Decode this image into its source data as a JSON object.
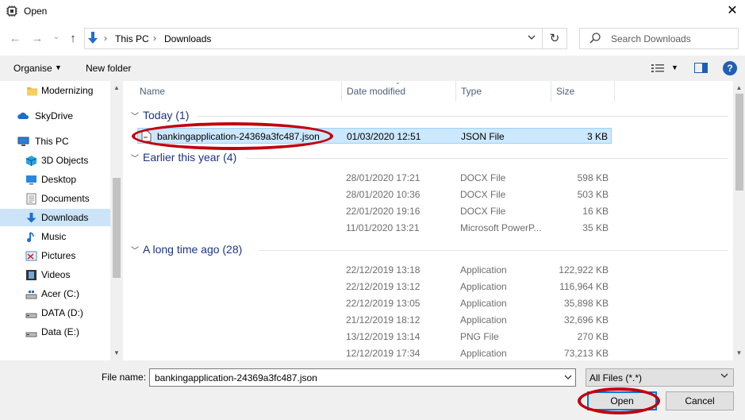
{
  "window": {
    "title": "Open",
    "close_glyph": "✕"
  },
  "navigation": {
    "back_glyph": "←",
    "forward_glyph": "→",
    "recent_glyph": "⌄",
    "up_glyph": "↑",
    "breadcrumb": [
      "This PC",
      "Downloads"
    ],
    "separator": "›",
    "refresh_glyph": "↻",
    "search_placeholder": "Search Downloads"
  },
  "toolbar": {
    "organise_label": "Organise",
    "new_folder_label": "New folder",
    "help_glyph": "?"
  },
  "sidebar": {
    "items": [
      {
        "label": "Modernizing",
        "icon": "folder-icon",
        "selected": false
      },
      {
        "label": "SkyDrive",
        "icon": "cloud-icon",
        "selected": false
      },
      {
        "label": "This PC",
        "icon": "computer-icon",
        "selected": false
      },
      {
        "label": "3D Objects",
        "icon": "3d-objects-icon",
        "selected": false
      },
      {
        "label": "Desktop",
        "icon": "desktop-icon",
        "selected": false
      },
      {
        "label": "Documents",
        "icon": "documents-icon",
        "selected": false
      },
      {
        "label": "Downloads",
        "icon": "downloads-icon",
        "selected": true
      },
      {
        "label": "Music",
        "icon": "music-icon",
        "selected": false
      },
      {
        "label": "Pictures",
        "icon": "pictures-icon",
        "selected": false
      },
      {
        "label": "Videos",
        "icon": "videos-icon",
        "selected": false
      },
      {
        "label": "Acer (C:)",
        "icon": "drive-c-icon",
        "selected": false
      },
      {
        "label": "DATA (D:)",
        "icon": "drive-icon",
        "selected": false
      },
      {
        "label": "Data (E:)",
        "icon": "drive-icon",
        "selected": false
      }
    ]
  },
  "columns": {
    "name": "Name",
    "date": "Date modified",
    "type": "Type",
    "size": "Size"
  },
  "groups": [
    {
      "title": "Today (1)",
      "rows": [
        {
          "name": "bankingapplication-24369a3fc487.json",
          "date": "01/03/2020 12:51",
          "type": "JSON File",
          "size": "3 KB",
          "selected": true
        }
      ]
    },
    {
      "title": "Earlier this year (4)",
      "rows": [
        {
          "name": "",
          "date": "28/01/2020 17:21",
          "type": "DOCX File",
          "size": "598 KB"
        },
        {
          "name": "",
          "date": "28/01/2020 10:36",
          "type": "DOCX File",
          "size": "503 KB"
        },
        {
          "name": "",
          "date": "22/01/2020 19:16",
          "type": "DOCX File",
          "size": "16 KB"
        },
        {
          "name": "",
          "date": "11/01/2020 13:21",
          "type": "Microsoft PowerP...",
          "size": "35 KB"
        }
      ]
    },
    {
      "title": "A long time ago (28)",
      "rows": [
        {
          "name": "",
          "date": "22/12/2019 13:18",
          "type": "Application",
          "size": "122,922 KB"
        },
        {
          "name": "",
          "date": "22/12/2019 13:12",
          "type": "Application",
          "size": "116,964 KB"
        },
        {
          "name": "",
          "date": "22/12/2019 13:05",
          "type": "Application",
          "size": "35,898 KB"
        },
        {
          "name": "",
          "date": "21/12/2019 18:12",
          "type": "Application",
          "size": "32,696 KB"
        },
        {
          "name": "",
          "date": "13/12/2019 13:14",
          "type": "PNG File",
          "size": "270 KB"
        },
        {
          "name": "",
          "date": "12/12/2019 17:34",
          "type": "Application",
          "size": "73,213 KB"
        }
      ]
    }
  ],
  "footer": {
    "file_name_label": "File name:",
    "file_name_value": "bankingapplication-24369a3fc487.json",
    "filter_value": "All Files (*.*)",
    "open_label": "Open",
    "cancel_label": "Cancel"
  },
  "annotations": {
    "color": "#c0000e"
  }
}
